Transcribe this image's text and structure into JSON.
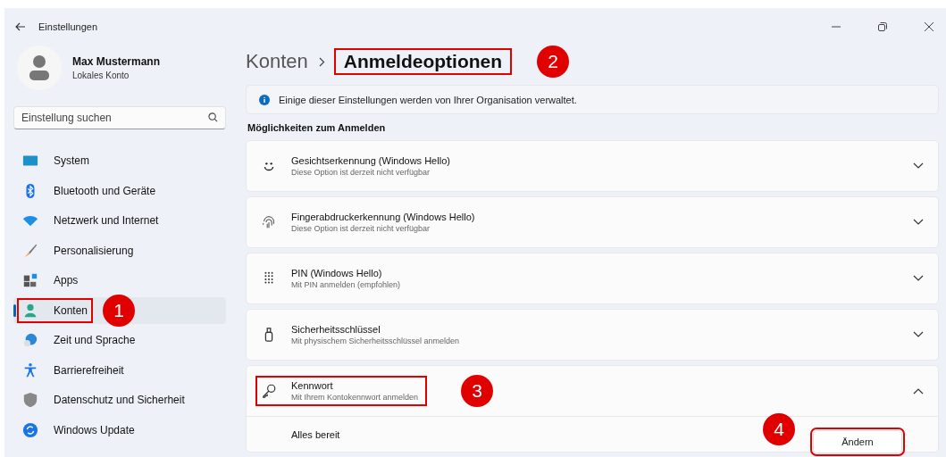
{
  "window": {
    "title": "Einstellungen"
  },
  "user": {
    "name": "Max Mustermann",
    "account": "Lokales Konto"
  },
  "search": {
    "placeholder": "Einstellung suchen"
  },
  "sidebar": {
    "items": [
      {
        "kind": "system",
        "label": "System",
        "selected": false
      },
      {
        "kind": "bluetooth",
        "label": "Bluetooth und Geräte",
        "selected": false
      },
      {
        "kind": "network",
        "label": "Netzwerk und Internet",
        "selected": false
      },
      {
        "kind": "brush",
        "label": "Personalisierung",
        "selected": false
      },
      {
        "kind": "apps",
        "label": "Apps",
        "selected": false
      },
      {
        "kind": "person",
        "label": "Konten",
        "selected": true,
        "marked": true,
        "badge": "1"
      },
      {
        "kind": "clock",
        "label": "Zeit und Sprache",
        "selected": false
      },
      {
        "kind": "access",
        "label": "Barrierefreiheit",
        "selected": false
      },
      {
        "kind": "shield",
        "label": "Datenschutz und Sicherheit",
        "selected": false
      },
      {
        "kind": "update",
        "label": "Windows Update",
        "selected": false
      }
    ]
  },
  "breadcrumb": {
    "parent": "Konten",
    "current": "Anmeldeoptionen",
    "marked": true,
    "badge": "2"
  },
  "notice": "Einige dieser Einstellungen werden von Ihrer Organisation verwaltet.",
  "section_title": "Möglichkeiten zum Anmelden",
  "options": [
    {
      "kind": "face",
      "title": "Gesichtserkennung (Windows Hello)",
      "subtitle": "Diese Option ist derzeit nicht verfügbar",
      "expanded": false
    },
    {
      "kind": "fingerprint",
      "title": "Fingerabdruckerkennung (Windows Hello)",
      "subtitle": "Diese Option ist derzeit nicht verfügbar",
      "expanded": false
    },
    {
      "kind": "pin",
      "title": "PIN (Windows Hello)",
      "subtitle": "Mit PIN anmelden (empfohlen)",
      "expanded": false
    },
    {
      "kind": "usbkey",
      "title": "Sicherheitsschlüssel",
      "subtitle": "Mit physischem Sicherheitsschlüssel anmelden",
      "expanded": false
    },
    {
      "kind": "key",
      "title": "Kennwort",
      "subtitle": "Mit Ihrem Kontokennwort anmelden",
      "expanded": true,
      "marked": true,
      "badge": "3",
      "detail": {
        "text": "Alles bereit",
        "button": "Ändern",
        "marked": true,
        "badge": "4"
      }
    }
  ]
}
